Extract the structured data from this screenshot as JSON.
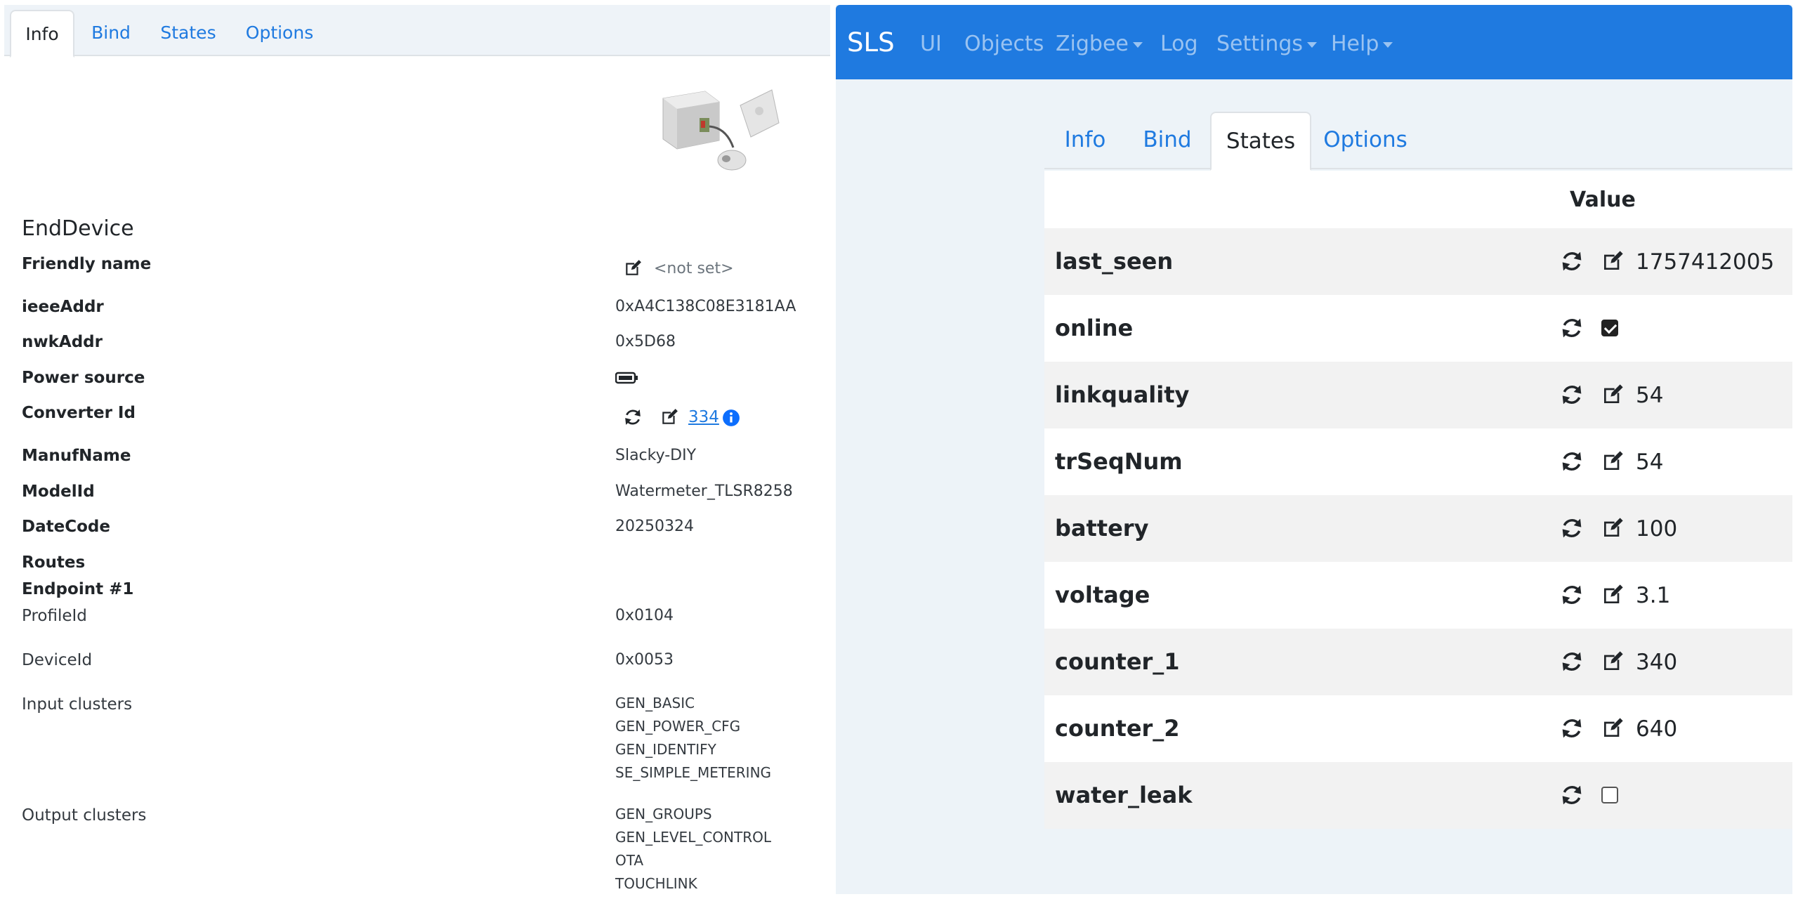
{
  "left": {
    "tabs": [
      "Info",
      "Bind",
      "States",
      "Options"
    ],
    "active_tab": "Info",
    "device_type": "EndDevice",
    "fields": {
      "friendly_name": {
        "label": "Friendly name",
        "value": "<not set>"
      },
      "ieee_addr": {
        "label": "ieeeAddr",
        "value": "0xA4C138C08E3181AA"
      },
      "nwk_addr": {
        "label": "nwkAddr",
        "value": "0x5D68"
      },
      "power_source": {
        "label": "Power source",
        "icon": "battery-icon"
      },
      "converter_id": {
        "label": "Converter Id",
        "value": "334"
      },
      "manuf_name": {
        "label": "ManufName",
        "value": "Slacky-DIY"
      },
      "model_id": {
        "label": "ModelId",
        "value": "Watermeter_TLSR8258"
      },
      "date_code": {
        "label": "DateCode",
        "value": "20250324"
      },
      "routes": {
        "label": "Routes"
      },
      "endpoint": {
        "label": "Endpoint #1"
      },
      "profile_id": {
        "label": "ProfileId",
        "value": "0x0104"
      },
      "device_id": {
        "label": "DeviceId",
        "value": "0x0053"
      },
      "input_clusters": {
        "label": "Input clusters",
        "values": [
          "GEN_BASIC",
          "GEN_POWER_CFG",
          "GEN_IDENTIFY",
          "SE_SIMPLE_METERING"
        ]
      },
      "output_clusters": {
        "label": "Output clusters",
        "values": [
          "GEN_GROUPS",
          "GEN_LEVEL_CONTROL",
          "OTA",
          "TOUCHLINK"
        ]
      }
    }
  },
  "navbar": {
    "brand": "SLS",
    "items": [
      "UI",
      "Objects",
      "Zigbee",
      "Log",
      "Settings",
      "Help"
    ],
    "dropdown_items": [
      "Zigbee",
      "Settings",
      "Help"
    ]
  },
  "right": {
    "tabs": [
      "Info",
      "Bind",
      "States",
      "Options"
    ],
    "active_tab": "States",
    "table_header": "Value",
    "rows": [
      {
        "name": "last_seen",
        "value": "1757412005",
        "type": "text"
      },
      {
        "name": "online",
        "value": "",
        "type": "checkbox",
        "checked": true
      },
      {
        "name": "linkquality",
        "value": "54",
        "type": "text"
      },
      {
        "name": "trSeqNum",
        "value": "54",
        "type": "text"
      },
      {
        "name": "battery",
        "value": "100",
        "type": "text"
      },
      {
        "name": "voltage",
        "value": "3.1",
        "type": "text"
      },
      {
        "name": "counter_1",
        "value": "340",
        "type": "text"
      },
      {
        "name": "counter_2",
        "value": "640",
        "type": "text"
      },
      {
        "name": "water_leak",
        "value": "",
        "type": "checkbox",
        "checked": false
      }
    ]
  },
  "colors": {
    "primary": "#1f7ae0",
    "info_blue": "#0d6efd"
  }
}
